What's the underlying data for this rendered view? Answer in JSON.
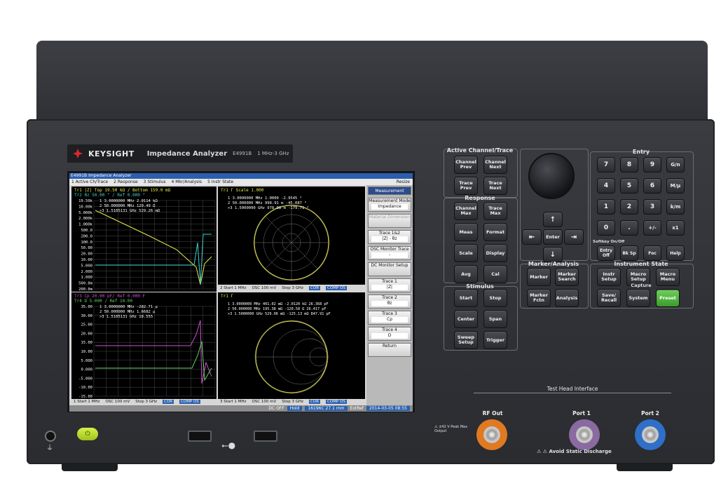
{
  "brand": {
    "logo": "KEYSIGHT",
    "product": "Impedance Analyzer",
    "model": "E4991B",
    "range": "1 MHz-3 GHz"
  },
  "screen": {
    "window_title": "E4991B Impedance Analyzer",
    "menu": [
      "1 Active Ch/Trace",
      "2 Response",
      "3 Stimulus",
      "4 Mkr/Analysis",
      "5 Instr State"
    ],
    "resize": "Resize",
    "pane_tl": {
      "header1": "Tr1 |Z|  Top 19.50 kΩ / Bottom 159.0 mΩ",
      "header2": "Tr2 θz   50.00 ° / Ref 0.000 °",
      "markers": [
        "1  3.0000000 MHz   2.0114 kΩ",
        "2  50.000000 MHz   120.49 Ω",
        ">3  1.5105131 GHz  529.26 mΩ"
      ],
      "ticks": [
        "19.50k",
        "10.00k",
        "5.000k",
        "2.000k",
        "1.000k",
        "500.0",
        "200.0",
        "100.0",
        "50.00",
        "20.00",
        "10.00",
        "5.000",
        "2.000",
        "1.000",
        "500.0m",
        "200.0m"
      ]
    },
    "pane_bl": {
      "header1": "Tr3 Cp   20.00 pF/ Ref 0.000 F",
      "header2": "Tr4 D    5.000 / Ref 10.00",
      "markers": [
        "1  3.0000000 MHz  -282.71 μ",
        "2  50.000000 MHz   1.6682 μ",
        ">3  1.5105131 GHz  18.555"
      ],
      "ticks": [
        "35.00",
        "30.00",
        "25.00",
        "20.00",
        "15.00",
        "10.00",
        "5.000",
        "0.000",
        "-5.000",
        "-10.00",
        "-15.00"
      ],
      "status": [
        "1  Start 1 MHz",
        "OSC 100 mV",
        "Stop 3 GHz"
      ]
    },
    "pane_tr": {
      "header": "Tr1 Γ     Scale 1.000",
      "markers": [
        "1  3.0000000 MHz  1.0000   -2.9545 °",
        "2  50.000000 MHz  998.91 m  -45.087 °",
        ">3  1.5000000 GHz  978.98 m  -179.71 °"
      ],
      "status": [
        "2  Start 1 MHz",
        "OSC 100 mV",
        "Stop 3 GHz"
      ]
    },
    "pane_br": {
      "header": "Tr1 Γ",
      "markers": [
        "1  3.0000000 MHz  401.02 mΩ  -2.0120 kΩ  26.368 pF",
        "2  50.000000 MHz  195.38 mΩ  -120.58 Ω  26.417 pF",
        ">3  1.5000000 GHz  529.96 mΩ  -125.13 mΩ  847.91 pF"
      ],
      "status": [
        "3  Start 1 MHz",
        "OSC 100 mV",
        "Stop 3 GHz"
      ]
    },
    "tags": [
      "COR",
      "COMP OS"
    ],
    "bottom": {
      "dc": "DC OFF",
      "hold": "Hold",
      "fixture": "16196C 27.1 mm",
      "ext": "ExtRef",
      "datetime": "2014-03-05 08:55"
    },
    "softkeys": {
      "title": "Measurement",
      "items": [
        {
          "label": "Measurement Mode",
          "value": "Impedance"
        },
        {
          "label": "Material Dimension",
          "value": ""
        },
        {
          "label": "Trace 1&2",
          "value": "|Z| - θz"
        },
        {
          "label": "OSC Monitor Trace",
          "value": "-"
        },
        {
          "label": "DC Monitor Setup",
          "value": ""
        },
        {
          "label": "Trace 1",
          "value": "|Z|"
        },
        {
          "label": "Trace 2",
          "value": "θz"
        },
        {
          "label": "Trace 3",
          "value": "Cp"
        },
        {
          "label": "Trace 4",
          "value": "D"
        },
        {
          "label": "Return",
          "value": ""
        }
      ]
    }
  },
  "panel": {
    "active_title": "Active Channel/Trace",
    "active_keys": [
      "Channel Prev",
      "Channel Next",
      "Trace Prev",
      "Trace Next"
    ],
    "response_title": "Response",
    "response_keys": [
      "Channel Max",
      "Trace Max",
      "Meas",
      "Format",
      "Scale",
      "Display",
      "Avg",
      "Cal"
    ],
    "stimulus_title": "Stimulus",
    "stimulus_keys": [
      "Start",
      "Stop",
      "Center",
      "Span",
      "Sweep Setup",
      "Trigger"
    ],
    "nav_enter": "Enter",
    "marker_title": "Marker/Analysis",
    "marker_keys": [
      "Marker",
      "Marker Search",
      "Marker Fctn",
      "Analysis"
    ],
    "entry_title": "Entry",
    "entry_keys": [
      "7",
      "8",
      "9",
      "G/n",
      "4",
      "5",
      "6",
      "M/μ",
      "1",
      "2",
      "3",
      "k/m",
      "0",
      ".",
      "+/-",
      "x1"
    ],
    "softkey_label": "Softkey On/Off",
    "entry_bottom": [
      "Entry Off",
      "Bk Sp",
      "Foc",
      "Help"
    ],
    "instr_title": "Instrument State",
    "instr_keys": [
      "Instr Setup",
      "Macro Setup",
      "Macro Menu"
    ],
    "capture_title": "Capture",
    "capture_keys": [
      "Save/ Recall",
      "System",
      "Preset"
    ],
    "test_head": "Test Head Interface",
    "rf_out": "RF Out",
    "port1": "Port 1",
    "port2": "Port 2",
    "warning": "±42 V Peak Max Output",
    "static": "Avoid Static Discharge"
  },
  "colors": {
    "trace_yellow": "#e8e84a",
    "trace_cyan": "#3ed0d0",
    "trace_magenta": "#d050d0",
    "trace_green": "#5fd05f",
    "preset_green": "#4fb83c",
    "rf_orange": "#e07a20",
    "port1_purple": "#8a6aa0",
    "port2_blue": "#2f6fc8"
  }
}
